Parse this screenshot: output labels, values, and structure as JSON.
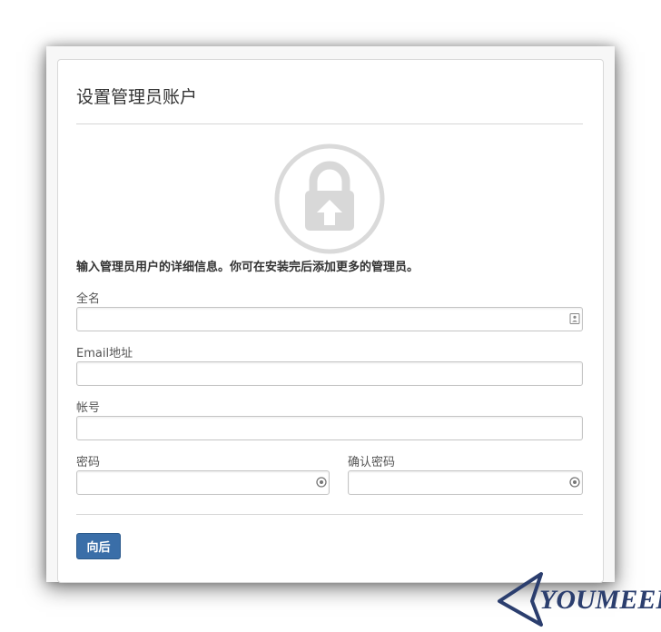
{
  "page": {
    "title": "设置管理员账户",
    "intro": "输入管理员用户的详细信息。你可在安装完后添加更多的管理员。"
  },
  "form": {
    "fullname": {
      "label": "全名",
      "value": "",
      "icon": "contact-card-icon"
    },
    "email": {
      "label": "Email地址",
      "value": ""
    },
    "username": {
      "label": "帐号",
      "value": ""
    },
    "password": {
      "label": "密码",
      "value": "",
      "icon": "password-key-icon"
    },
    "confirm_password": {
      "label": "确认密码",
      "value": "",
      "icon": "password-key-icon"
    }
  },
  "actions": {
    "next_label": "向后"
  },
  "brand": {
    "name": "YOUMEEK"
  },
  "colors": {
    "primary_button": "#3a6ea8",
    "lock_icon": "#dadada",
    "brand": "#2b3e6e"
  }
}
